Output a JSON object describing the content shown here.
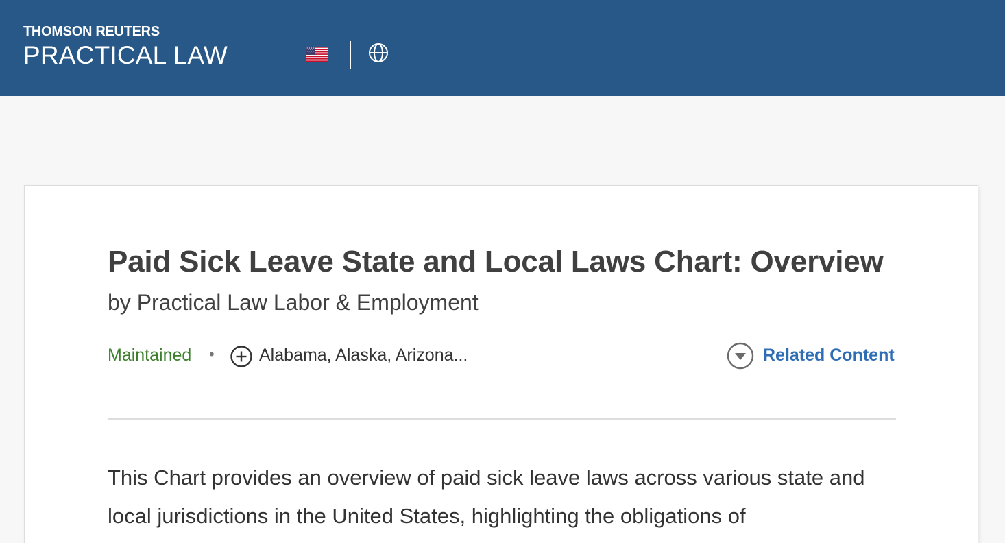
{
  "header": {
    "brand_top": "THOMSON REUTERS",
    "brand_bottom": "PRACTICAL LAW",
    "flag_icon": "us-flag-icon",
    "globe_icon": "globe-icon"
  },
  "document": {
    "title": "Paid Sick Leave State and Local Laws Chart: Overview",
    "author": "by Practical Law Labor & Employment",
    "status": "Maintained",
    "separator": "•",
    "jurisdictions": "Alabama, Alaska, Arizona...",
    "related_label": "Related Content",
    "body": "This Chart provides an overview of paid sick leave laws across various state and local jurisdictions in the United States, highlighting the obligations of"
  },
  "colors": {
    "header_bg": "#275887",
    "page_bg": "#f7f7f7",
    "status_green": "#3c7f2c",
    "link_blue": "#2f6db5"
  }
}
